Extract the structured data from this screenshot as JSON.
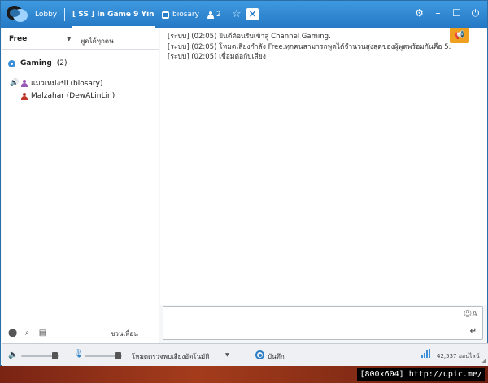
{
  "titlebar": {
    "lobby": "Lobby",
    "channel_tab": "[ SS ] In Game 9 Yin",
    "user_tab": "biosary",
    "user_count": "2"
  },
  "left": {
    "mode": "Free",
    "mode_sub": "พูดได้ทุกคน",
    "channel_name": "Gaming",
    "channel_count": "(2)",
    "members": [
      {
        "name": "แมวเหม่ง*ll (biosary)",
        "color": "#9b59b6"
      },
      {
        "name": "Malzahar (DewALinLin)",
        "color": "#c0392b"
      }
    ],
    "invite": "ชวนเพื่อน"
  },
  "chat": {
    "lines": [
      "[ระบบ] (02:05) ยินดีต้อนรับเข้าสู่ Channel Gaming.",
      "[ระบบ] (02:05) โหมดเสียงกำลัง Free.ทุกคนสามารถพูดได้จำนวนสูงสุดของผู้พูดพร้อมกันคือ 5.",
      "[ระบบ] (02:05) เชื่อมต่อกับเสียง"
    ]
  },
  "bottom": {
    "vad": "โหมดตรวจพบเสียงอัตโนมัติ",
    "record": "บันทึก",
    "online": "42,537 ออนไลน์"
  },
  "footer": {
    "text": "[800x604] http://upic.me/"
  },
  "colors": {
    "titlebar": "#2478c4",
    "accent": "#3a8fd8",
    "announce": "#f0a020"
  }
}
